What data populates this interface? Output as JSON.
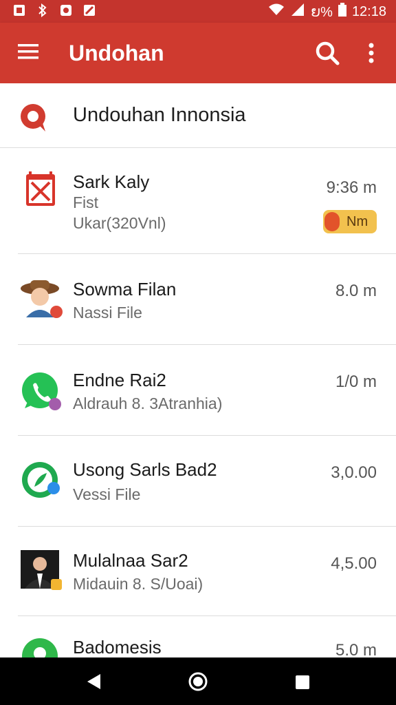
{
  "status_bar": {
    "battery_text": "ຍ%",
    "time": "12:18",
    "icons": [
      "notification-icon",
      "bluetooth-icon",
      "sync-icon",
      "no-signal-icon",
      "wifi-icon",
      "cell-signal-icon",
      "battery-icon"
    ]
  },
  "app_bar": {
    "title": "Undohan",
    "icons": [
      "menu-icon",
      "search-icon",
      "more-vert-icon"
    ]
  },
  "search_row": {
    "text": "Undouhan Innonsia",
    "icon": "location-pin-icon"
  },
  "items": [
    {
      "title": "Sark Kaly",
      "subtitle": "Fist",
      "subtitle2": "Ukar(320Vnl)",
      "time": "9:36 m",
      "badge": "Nm",
      "icon": "calendar-app-icon",
      "accent": "#d8342a"
    },
    {
      "title": "Sowma Filan",
      "subtitle": "Nassi File",
      "time": "8.0 m",
      "icon": "avatar-icon",
      "accent": "#e04a3a"
    },
    {
      "title": "Endne Rai2",
      "subtitle": "Aldrauh 8. 3Atranhia)",
      "time": "1/0 m",
      "icon": "whatsapp-icon",
      "accent": "#25c155"
    },
    {
      "title": "Usong Sarls Bad2",
      "subtitle": "Vessi File",
      "time": "3,0.00",
      "icon": "feather-app-icon",
      "accent": "#1fa94f"
    },
    {
      "title": "Mulalnaa Sar2",
      "subtitle": "Midauin 8. S/Uoai)",
      "time": "4,5.00",
      "icon": "person-photo-icon",
      "accent": "#f2b531"
    },
    {
      "title": "Badomesis",
      "time": "5.0 m",
      "icon": "group-app-icon",
      "accent": "#2fb84a"
    }
  ],
  "nav_bar": {
    "icons": [
      "back-icon",
      "home-icon",
      "recents-icon"
    ]
  },
  "colors": {
    "primary": "#cf3a2f",
    "status_bar": "#c4342d",
    "badge": "#f2c14e"
  }
}
